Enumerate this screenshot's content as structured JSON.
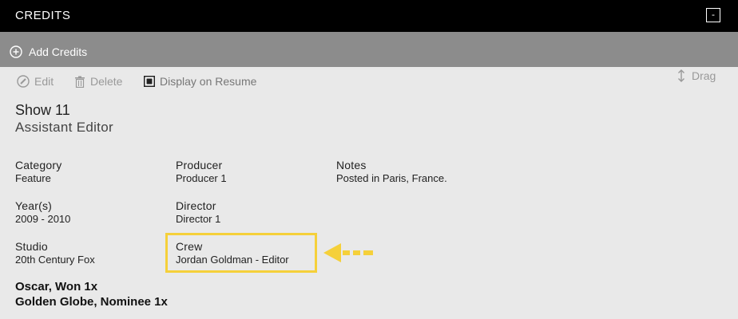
{
  "header": {
    "title": "CREDITS",
    "collapse_label": "-"
  },
  "add_bar": {
    "label": "Add Credits"
  },
  "toolbar": {
    "edit": "Edit",
    "delete": "Delete",
    "display": "Display on Resume",
    "drag": "Drag"
  },
  "credit": {
    "title": "Show 11",
    "role": "Assistant Editor",
    "fields": {
      "category": {
        "label": "Category",
        "value": "Feature"
      },
      "years": {
        "label": "Year(s)",
        "value": "2009 - 2010"
      },
      "studio": {
        "label": "Studio",
        "value": "20th Century Fox"
      },
      "producer": {
        "label": "Producer",
        "value": "Producer 1"
      },
      "director": {
        "label": "Director",
        "value": "Director 1"
      },
      "crew": {
        "label": "Crew",
        "value": "Jordan Goldman - Editor"
      },
      "notes": {
        "label": "Notes",
        "value": "Posted in Paris, France."
      }
    },
    "awards": [
      "Oscar, Won 1x",
      "Golden Globe, Nominee 1x"
    ]
  },
  "colors": {
    "highlight": "#f5d03a",
    "header_bg": "#000000",
    "add_bar_bg": "#8c8c8c",
    "page_bg": "#e9e9e9"
  },
  "icons": [
    "plus-circle-icon",
    "pencil-circle-icon",
    "trash-icon",
    "checkbox-icon",
    "updown-arrow-icon",
    "left-arrow-icon"
  ]
}
